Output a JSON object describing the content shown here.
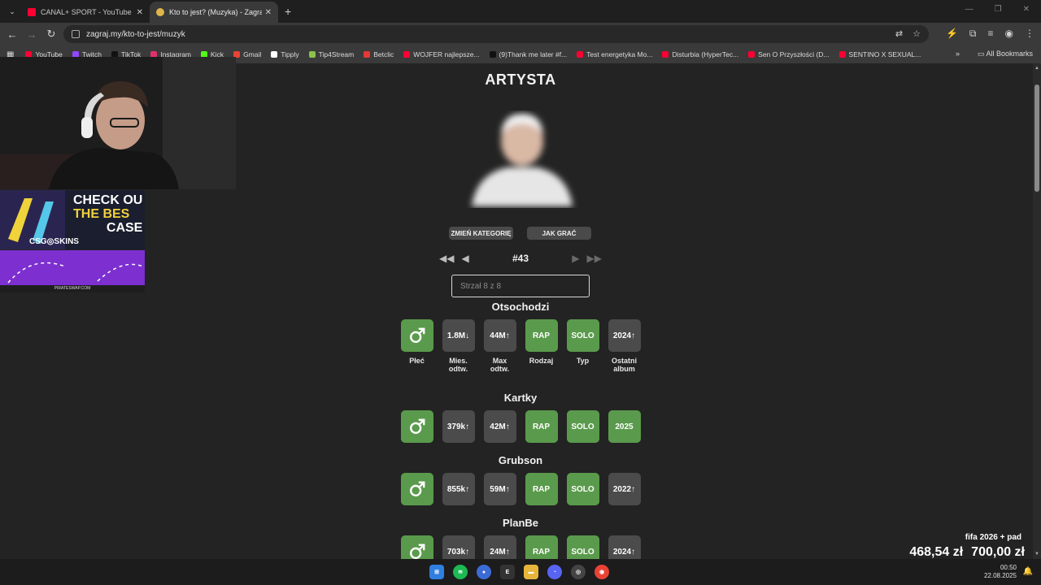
{
  "browser": {
    "tabs": [
      {
        "title": "CANAL+ SPORT - YouTube",
        "active": false
      },
      {
        "title": "Kto to jest? (Muzyka) - Zagraj.my",
        "active": true
      }
    ],
    "url": "zagraj.my/kto-to-jest/muzyk",
    "bookmarks": [
      {
        "label": "YouTube",
        "color": "#ff0033"
      },
      {
        "label": "Twitch",
        "color": "#9146ff"
      },
      {
        "label": "TikTok",
        "color": "#111111"
      },
      {
        "label": "Instagram",
        "color": "#e1306c"
      },
      {
        "label": "Kick",
        "color": "#53fc18"
      },
      {
        "label": "Gmail",
        "color": "#ea4335"
      },
      {
        "label": "Tipply",
        "color": "#ffffff"
      },
      {
        "label": "Tip4Stream",
        "color": "#8bc34a"
      },
      {
        "label": "Betclic",
        "color": "#e53935"
      },
      {
        "label": "WOJFER najlepsze...",
        "color": "#ff0033"
      },
      {
        "label": "(9)Thank me later #f...",
        "color": "#111111"
      },
      {
        "label": "Test energetyka Mo...",
        "color": "#ff0033"
      },
      {
        "label": "Disturbia (HyperTec...",
        "color": "#ff0033"
      },
      {
        "label": "Sen O Przyszłości (D...",
        "color": "#ff0033"
      },
      {
        "label": "SENTINO X SEXUAL...",
        "color": "#ff0033"
      }
    ],
    "all_bookmarks": "All Bookmarks"
  },
  "page": {
    "heading": "ARTYSTA",
    "change_category": "ZMIEŃ KATEGORIĘ",
    "how_to_play": "JAK GRAĆ",
    "puzzle_number": "#43",
    "input_placeholder": "Strzał 8 z 8",
    "column_labels": [
      "Płeć",
      "Mies. odtw.",
      "Max odtw.",
      "Rodzaj",
      "Typ",
      "Ostatni album"
    ],
    "guesses": [
      {
        "name": "Otsochodzi",
        "tiles": [
          {
            "text": "",
            "icon": "male-symbol-icon",
            "status": "correct"
          },
          {
            "text": "1.8M↓",
            "status": "wrong"
          },
          {
            "text": "44M↑",
            "status": "wrong"
          },
          {
            "text": "RAP",
            "status": "correct"
          },
          {
            "text": "SOLO",
            "status": "correct"
          },
          {
            "text": "2024↑",
            "status": "wrong"
          }
        ]
      },
      {
        "name": "Kartky",
        "tiles": [
          {
            "text": "",
            "icon": "male-symbol-icon",
            "status": "correct"
          },
          {
            "text": "379k↑",
            "status": "wrong"
          },
          {
            "text": "42M↑",
            "status": "wrong"
          },
          {
            "text": "RAP",
            "status": "correct"
          },
          {
            "text": "SOLO",
            "status": "correct"
          },
          {
            "text": "2025",
            "status": "correct"
          }
        ]
      },
      {
        "name": "Grubson",
        "tiles": [
          {
            "text": "",
            "icon": "male-symbol-icon",
            "status": "correct"
          },
          {
            "text": "855k↑",
            "status": "wrong"
          },
          {
            "text": "59M↑",
            "status": "wrong"
          },
          {
            "text": "RAP",
            "status": "correct"
          },
          {
            "text": "SOLO",
            "status": "correct"
          },
          {
            "text": "2022↑",
            "status": "wrong"
          }
        ]
      },
      {
        "name": "PlanBe",
        "tiles": [
          {
            "text": "",
            "icon": "male-symbol-icon",
            "status": "correct"
          },
          {
            "text": "703k↑",
            "status": "wrong"
          },
          {
            "text": "24M↑",
            "status": "wrong"
          },
          {
            "text": "RAP",
            "status": "correct"
          },
          {
            "text": "SOLO",
            "status": "correct"
          },
          {
            "text": "2024↑",
            "status": "wrong"
          }
        ]
      }
    ],
    "colors": {
      "correct": "#5a9a4c",
      "wrong": "#4b4b4b",
      "background": "#232323"
    }
  },
  "overlay": {
    "ad1_line1": "CHECK OU",
    "ad1_line2": "THE BES",
    "ad1_line3": "CASE",
    "ad1_brand": "CSG◎SKINS",
    "ad2_footer": "PIRATESWAP.COM",
    "donation_goal": "fifa 2026 + pad",
    "donation_current": "468,54 zł",
    "donation_target": "700,00 zł"
  },
  "taskbar": {
    "time": "00:50",
    "date": "22.08.2025"
  }
}
